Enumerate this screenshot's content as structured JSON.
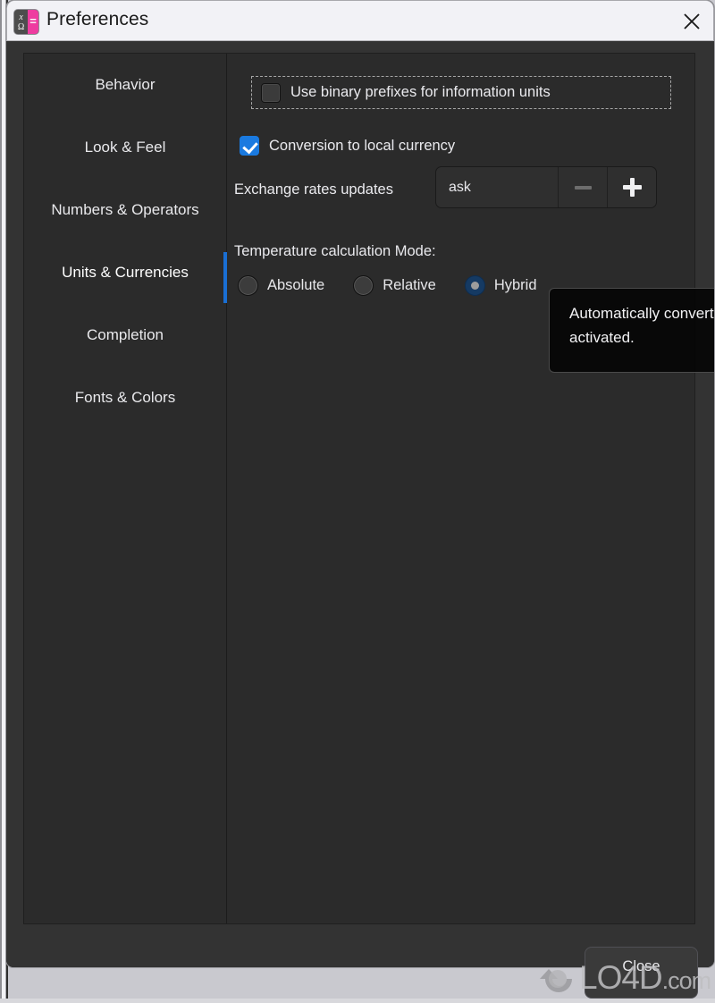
{
  "window": {
    "title": "Preferences",
    "app_icon": {
      "name": "calculator-icon",
      "glyph_top": "x",
      "glyph_bottom": "Ω",
      "glyph_right": "=",
      "accent_color": "#ee3ca0"
    },
    "close_icon": "close-icon"
  },
  "sidebar": {
    "items": [
      {
        "label": "Behavior",
        "active": false
      },
      {
        "label": "Look & Feel",
        "active": false
      },
      {
        "label": "Numbers & Operators",
        "active": false
      },
      {
        "label": "Units & Currencies",
        "active": true
      },
      {
        "label": "Completion",
        "active": false
      },
      {
        "label": "Fonts & Colors",
        "active": false
      }
    ],
    "active_indicator_color": "#1a6fd4"
  },
  "content": {
    "binary_prefixes": {
      "label": "Use binary prefixes for information units",
      "checked": false,
      "focused": true
    },
    "conversion_local_currency": {
      "label": "Conversion to local currency",
      "checked": true,
      "accent_color": "#1a7ae0"
    },
    "exchange_rates": {
      "label": "Exchange rates updates",
      "value": "ask",
      "decrement_icon": "minus-icon",
      "increment_icon": "plus-icon",
      "decrement_enabled": false,
      "increment_enabled": true
    },
    "temperature": {
      "label": "Temperature calculation Mode:",
      "options": [
        {
          "label": "Absolute",
          "selected": false
        },
        {
          "label": "Relative",
          "selected": false
        },
        {
          "label": "Hybrid",
          "selected": true
        }
      ]
    }
  },
  "tooltip": {
    "text": "Automatically convert to the local currency when activated."
  },
  "footer": {
    "close_label": "Close"
  },
  "watermark": {
    "text": "LO4D",
    "suffix": ".com"
  }
}
